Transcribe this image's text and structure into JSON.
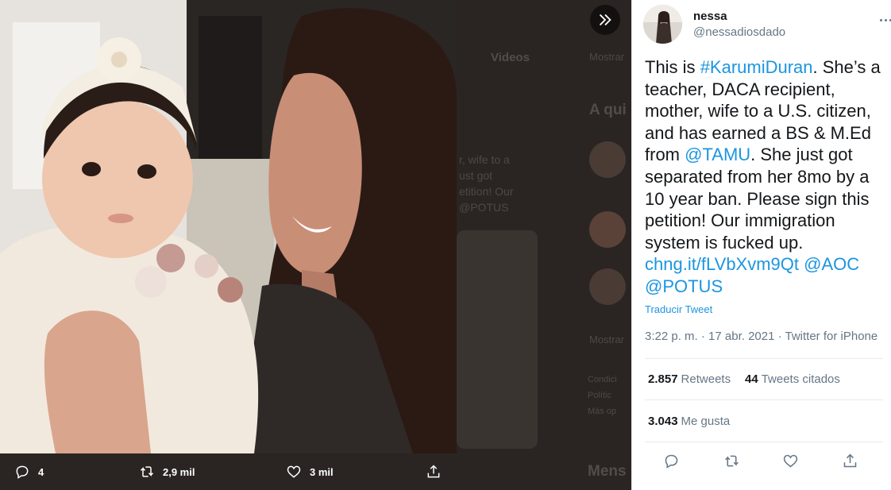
{
  "background_page": {
    "tab_videos": "Videos",
    "show_more": "Mostrar",
    "who_to_follow": "A qui",
    "snippet_line1": "r, wife to a",
    "snippet_line2": "ust got",
    "snippet_line3": "etition! Our",
    "snippet_line4": "@POTUS",
    "show_more_2": "Mostrar",
    "footer_1": "Condici",
    "footer_2": "Polític",
    "footer_3": "Más op",
    "messages": "Mens"
  },
  "media_actions": {
    "reply_count": "4",
    "retweet_count": "2,9 mil",
    "like_count": "3 mil"
  },
  "tweet": {
    "author_name": "nessa",
    "author_handle": "@nessadiosdado",
    "text_parts": [
      {
        "t": "This is ",
        "link": false
      },
      {
        "t": "#KarumiDuran",
        "link": true
      },
      {
        "t": ". She’s a teacher, DACA recipient, mother, wife to a U.S. citizen, and has earned a BS & M.Ed from ",
        "link": false
      },
      {
        "t": "@TAMU",
        "link": true
      },
      {
        "t": ". She just got separated from her 8mo by a 10 year ban. Please sign this petition! Our immigration system is fucked up. ",
        "link": false
      },
      {
        "t": "chng.it/fLVbXvm9Qt",
        "link": true
      },
      {
        "t": " ",
        "link": false
      },
      {
        "t": "@AOC",
        "link": true
      },
      {
        "t": " ",
        "link": false
      },
      {
        "t": "@POTUS",
        "link": true
      }
    ],
    "translate_label": "Traducir Tweet",
    "meta": "3:22 p. m. · 17 abr. 2021 · Twitter for iPhone",
    "retweets_value": "2.857",
    "retweets_label": "Retweets",
    "quotes_value": "44",
    "quotes_label": "Tweets citados",
    "likes_value": "3.043",
    "likes_label": "Me gusta"
  },
  "icons": [
    "reply-icon",
    "retweet-icon",
    "like-icon",
    "share-icon",
    "expand-icon",
    "more-icon"
  ],
  "colors": {
    "link": "#1b95e0",
    "text": "#14171a",
    "secondary": "#657786",
    "overlay": "#2b2623"
  }
}
